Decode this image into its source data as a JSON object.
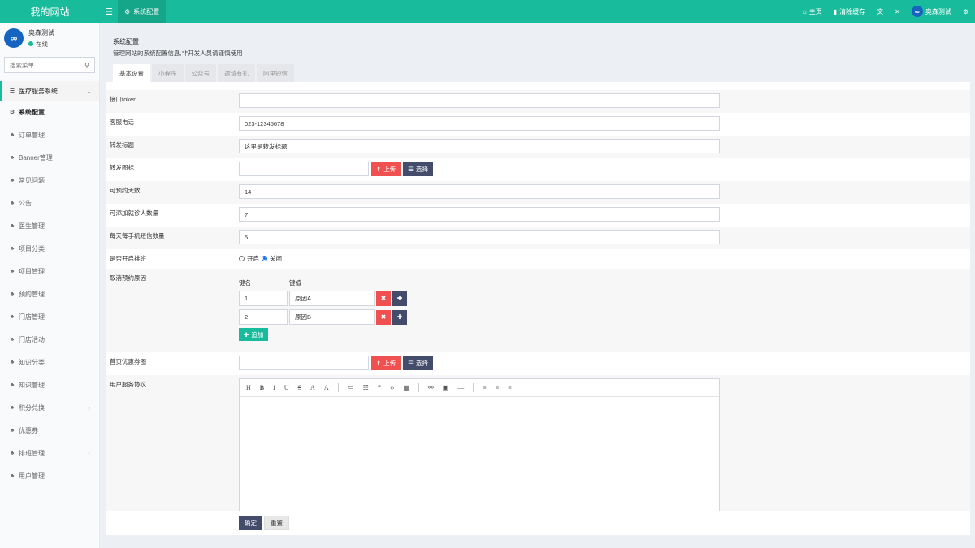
{
  "topbar": {
    "brand": "我的网站",
    "tab_label": "系统配置",
    "home": "主页",
    "clear_cache": "清除缓存",
    "user": "奥森测试"
  },
  "sidebar": {
    "user_name": "奥森测试",
    "user_status": "在线",
    "search_placeholder": "搜索菜单",
    "group": "医疗服务系统",
    "items": [
      {
        "label": "系统配置"
      },
      {
        "label": "订单管理"
      },
      {
        "label": "Banner管理"
      },
      {
        "label": "常见问题"
      },
      {
        "label": "公告"
      },
      {
        "label": "医生管理"
      },
      {
        "label": "项目分类"
      },
      {
        "label": "项目管理"
      },
      {
        "label": "预约管理"
      },
      {
        "label": "门店管理"
      },
      {
        "label": "门店活动"
      },
      {
        "label": "知识分类"
      },
      {
        "label": "知识管理"
      },
      {
        "label": "积分兑换"
      },
      {
        "label": "优惠券"
      },
      {
        "label": "排班管理"
      },
      {
        "label": "用户管理"
      }
    ]
  },
  "panel": {
    "title": "系统配置",
    "desc": "管理网站的系统配置信息,非开发人员请谨慎使用",
    "tabs": [
      "基本设置",
      "小程序",
      "公众号",
      "邀请有礼",
      "阿里短信"
    ]
  },
  "form": {
    "api_token_label": "接口token",
    "api_token_value": "",
    "phone_label": "客服电话",
    "phone_value": "023-12345678",
    "share_title_label": "转发标题",
    "share_title_value": "这里是转发标题",
    "share_icon_label": "转发图标",
    "upload": "上传",
    "choose": "选择",
    "days_label": "可预约天数",
    "days_value": "14",
    "patients_label": "可添加就诊人数量",
    "patients_value": "7",
    "sms_label": "每天每手机短信数量",
    "sms_value": "5",
    "schedule_label": "是否开启排班",
    "open": "开启",
    "close": "关闭",
    "cancel_label": "取消预约原因",
    "key_head": "键名",
    "val_head": "键值",
    "reasons": [
      {
        "key": "1",
        "val": "原因A"
      },
      {
        "key": "2",
        "val": "原因B"
      }
    ],
    "add": "追加",
    "coupon_label": "首页优惠券图",
    "agreement_label": "用户服务协议",
    "confirm": "确定",
    "reset": "重置"
  }
}
